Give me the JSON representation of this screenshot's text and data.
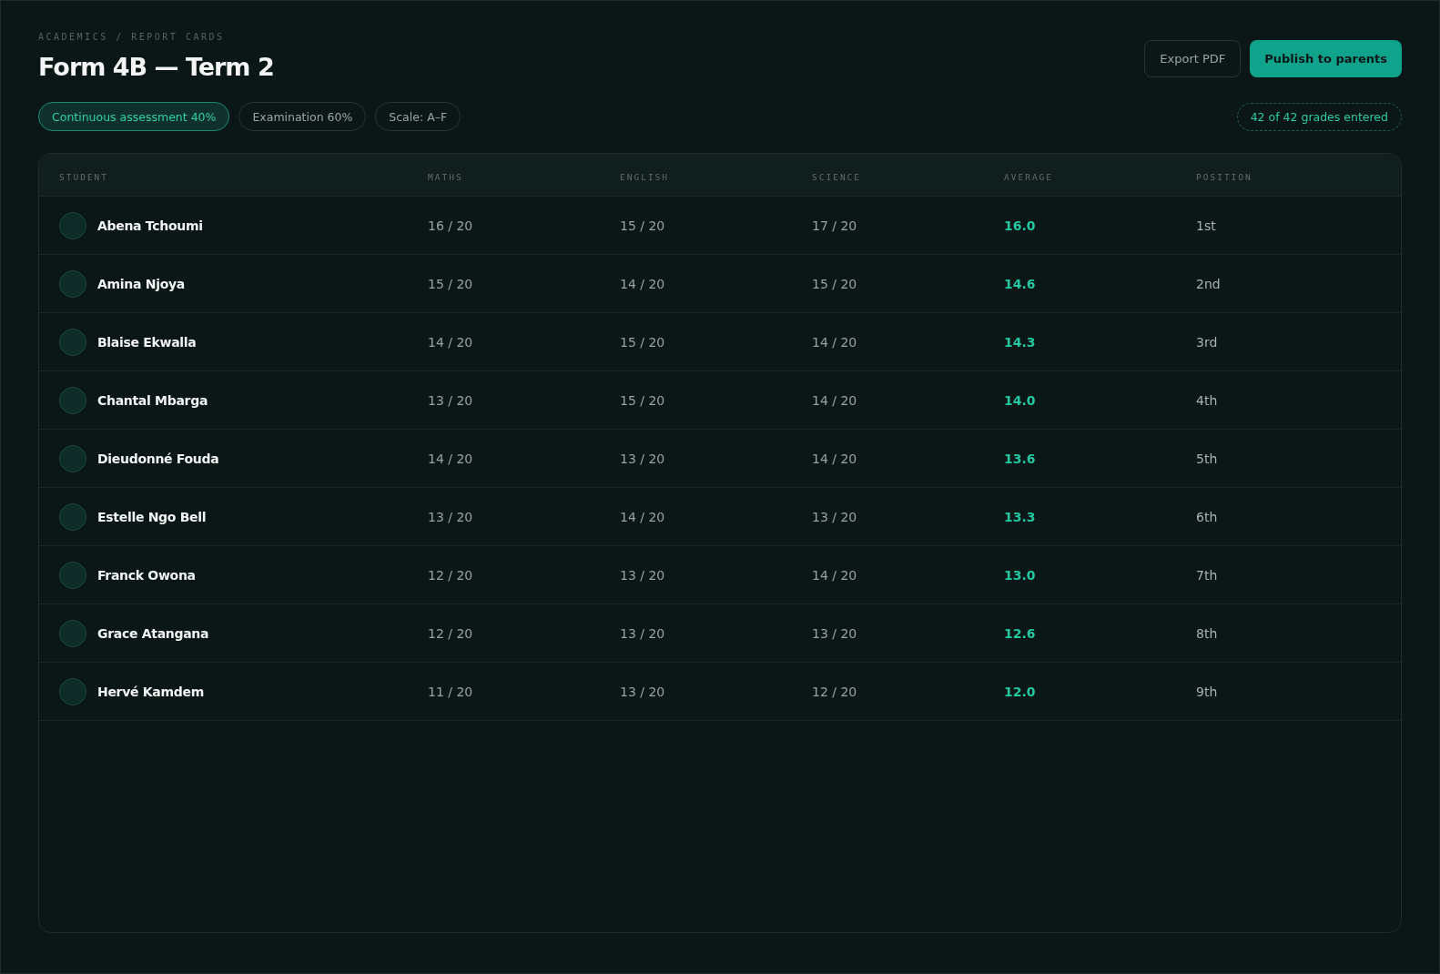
{
  "breadcrumb": "ACADEMICS / REPORT CARDS",
  "title": "Form 4B — Term 2",
  "buttons": [
    {
      "kind": "secondary",
      "label": "Export PDF"
    },
    {
      "kind": "primary",
      "label": "Publish to parents"
    }
  ],
  "chips": [
    {
      "label": "Continuous assessment 40%",
      "selected": true
    },
    {
      "label": "Examination 60%",
      "selected": false
    },
    {
      "label": "Scale: A–F",
      "selected": false
    }
  ],
  "status_badge": "42 of 42 grades entered",
  "table": {
    "columns": [
      "STUDENT",
      "MATHS",
      "ENGLISH",
      "SCIENCE",
      "AVERAGE",
      "POSITION"
    ],
    "rows": [
      {
        "student": "Abena Tchoumi",
        "maths": "16 / 20",
        "english": "15 / 20",
        "science": "17 / 20",
        "average": "16.0",
        "position": "1st"
      },
      {
        "student": "Amina Njoya",
        "maths": "15 / 20",
        "english": "14 / 20",
        "science": "15 / 20",
        "average": "14.6",
        "position": "2nd"
      },
      {
        "student": "Blaise Ekwalla",
        "maths": "14 / 20",
        "english": "15 / 20",
        "science": "14 / 20",
        "average": "14.3",
        "position": "3rd"
      },
      {
        "student": "Chantal Mbarga",
        "maths": "13 / 20",
        "english": "15 / 20",
        "science": "14 / 20",
        "average": "14.0",
        "position": "4th"
      },
      {
        "student": "Dieudonné Fouda",
        "maths": "14 / 20",
        "english": "13 / 20",
        "science": "14 / 20",
        "average": "13.6",
        "position": "5th"
      },
      {
        "student": "Estelle Ngo Bell",
        "maths": "13 / 20",
        "english": "14 / 20",
        "science": "13 / 20",
        "average": "13.3",
        "position": "6th"
      },
      {
        "student": "Franck Owona",
        "maths": "12 / 20",
        "english": "13 / 20",
        "science": "14 / 20",
        "average": "13.0",
        "position": "7th"
      },
      {
        "student": "Grace Atangana",
        "maths": "12 / 20",
        "english": "13 / 20",
        "science": "13 / 20",
        "average": "12.6",
        "position": "8th"
      },
      {
        "student": "Hervé Kamdem",
        "maths": "11 / 20",
        "english": "13 / 20",
        "science": "12 / 20",
        "average": "12.0",
        "position": "9th"
      }
    ]
  }
}
